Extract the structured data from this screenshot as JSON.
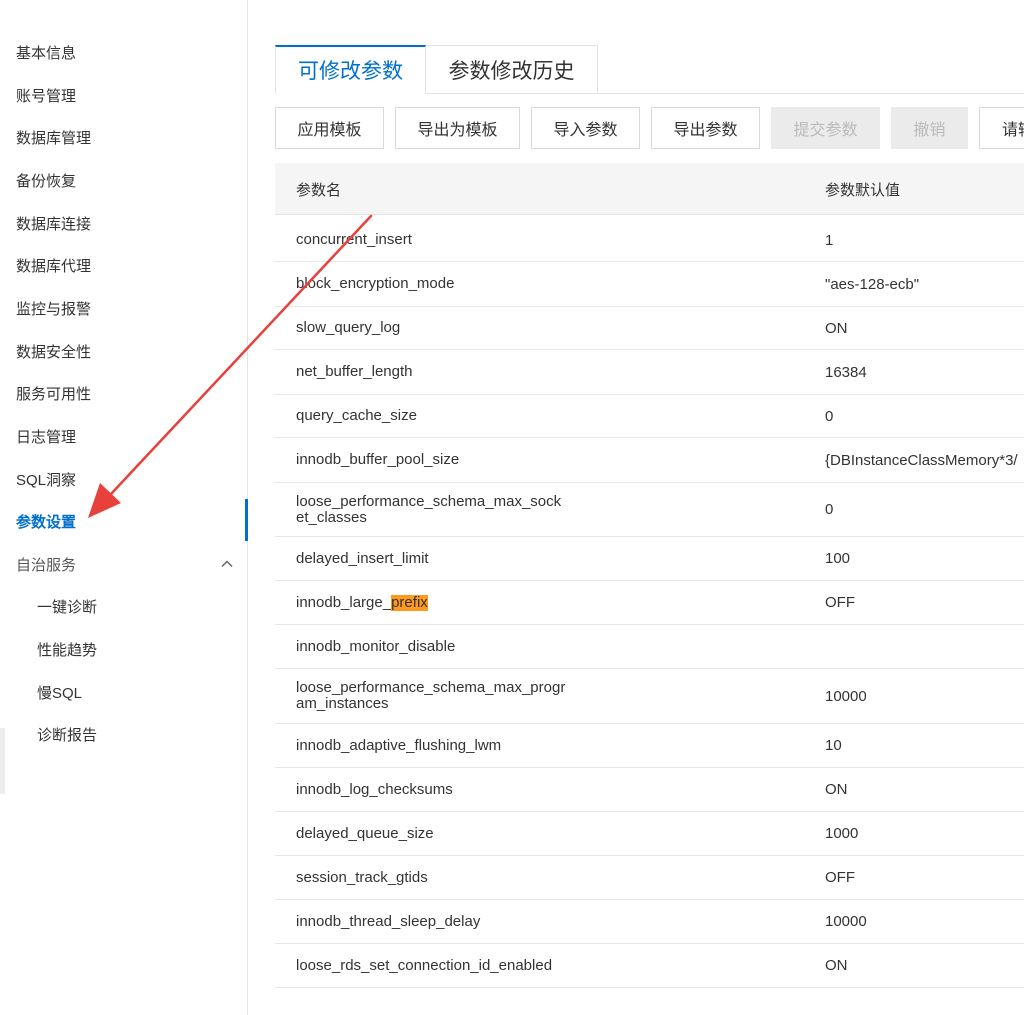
{
  "sidebar": {
    "items": [
      {
        "label": "基本信息"
      },
      {
        "label": "账号管理"
      },
      {
        "label": "数据库管理"
      },
      {
        "label": "备份恢复"
      },
      {
        "label": "数据库连接"
      },
      {
        "label": "数据库代理"
      },
      {
        "label": "监控与报警"
      },
      {
        "label": "数据安全性"
      },
      {
        "label": "服务可用性"
      },
      {
        "label": "日志管理"
      },
      {
        "label": "SQL洞察"
      },
      {
        "label": "参数设置",
        "active": true
      }
    ],
    "group": {
      "label": "自治服务",
      "icon": "chevron-up-icon",
      "children": [
        {
          "label": "一键诊断"
        },
        {
          "label": "性能趋势"
        },
        {
          "label": "慢SQL"
        },
        {
          "label": "诊断报告"
        }
      ]
    }
  },
  "tabs": [
    {
      "label": "可修改参数",
      "active": true
    },
    {
      "label": "参数修改历史",
      "active": false
    }
  ],
  "toolbar": {
    "apply_template": "应用模板",
    "export_as_template": "导出为模板",
    "import_params": "导入参数",
    "export_params": "导出参数",
    "submit_params": "提交参数",
    "revoke": "撤销",
    "search_placeholder_partial": "请输"
  },
  "table": {
    "columns": {
      "name": "参数名",
      "default_value": "参数默认值"
    },
    "rows": [
      {
        "name": "concurrent_insert",
        "default_value": "1"
      },
      {
        "name": "block_encryption_mode",
        "default_value": "\"aes-128-ecb\""
      },
      {
        "name": "slow_query_log",
        "default_value": "ON"
      },
      {
        "name": "net_buffer_length",
        "default_value": "16384"
      },
      {
        "name": "query_cache_size",
        "default_value": "0"
      },
      {
        "name": "innodb_buffer_pool_size",
        "default_value": "{DBInstanceClassMemory*3/"
      },
      {
        "name": "loose_performance_schema_max_socket_classes",
        "default_value": "0"
      },
      {
        "name": "delayed_insert_limit",
        "default_value": "100"
      },
      {
        "name_before_highlight": "innodb_large_",
        "name_highlight": "prefix",
        "default_value": "OFF"
      },
      {
        "name": "innodb_monitor_disable",
        "default_value": ""
      },
      {
        "name": "loose_performance_schema_max_program_instances",
        "default_value": "10000"
      },
      {
        "name": "innodb_adaptive_flushing_lwm",
        "default_value": "10"
      },
      {
        "name": "innodb_log_checksums",
        "default_value": "ON"
      },
      {
        "name": "delayed_queue_size",
        "default_value": "1000"
      },
      {
        "name": "session_track_gtids",
        "default_value": "OFF"
      },
      {
        "name": "innodb_thread_sleep_delay",
        "default_value": "10000"
      },
      {
        "name": "loose_rds_set_connection_id_enabled",
        "default_value": "ON"
      }
    ]
  },
  "colors": {
    "accent": "#0070cc",
    "highlight": "#ff9a1f",
    "annotation_arrow": "#e8403a"
  }
}
